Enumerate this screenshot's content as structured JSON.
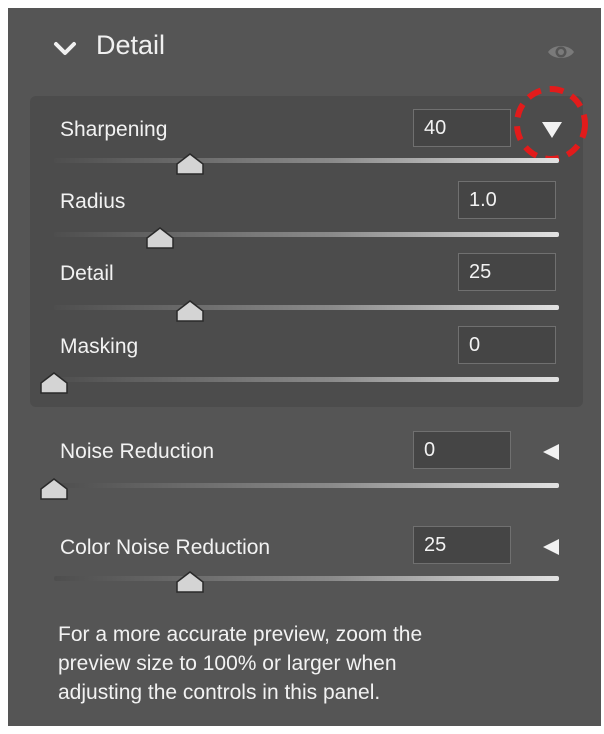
{
  "panel": {
    "title": "Detail",
    "icons": {
      "collapse": "chevron-down-icon",
      "visibility": "eye-icon",
      "disclosure_open": "triangle-down-icon",
      "disclosure_closed": "triangle-left-icon"
    },
    "colors": {
      "panel_bg": "#555555",
      "group_bg": "#4c4c4c",
      "highlight": "#e21b1b",
      "text": "#f2f2f2"
    }
  },
  "sharpening": {
    "label": "Sharpening",
    "value": "40",
    "fraction": 0.27,
    "sub": [
      {
        "label": "Radius",
        "value": "1.0",
        "fraction": 0.21
      },
      {
        "label": "Detail",
        "value": "25",
        "fraction": 0.27
      },
      {
        "label": "Masking",
        "value": "0",
        "fraction": 0.0
      }
    ]
  },
  "noise_reduction": {
    "label": "Noise Reduction",
    "value": "0",
    "fraction": 0.0
  },
  "color_noise_reduction": {
    "label": "Color Noise Reduction",
    "value": "25",
    "fraction": 0.27
  },
  "footer_note": {
    "line1": "For a more accurate preview, zoom the",
    "line2": "preview size to 100% or larger when",
    "line3": "adjusting the controls in this panel."
  }
}
